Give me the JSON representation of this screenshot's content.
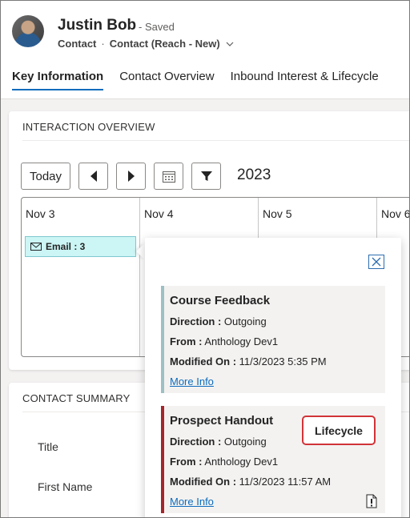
{
  "record": {
    "name": "Justin Bob",
    "saved_status": "- Saved",
    "entity": "Contact",
    "separator": "·",
    "form": "Contact (Reach - New)"
  },
  "tabs": [
    {
      "label": "Key Information",
      "active": true
    },
    {
      "label": "Contact Overview",
      "active": false
    },
    {
      "label": "Inbound Interest & Lifecycle",
      "active": false
    }
  ],
  "interaction_overview": {
    "title": "INTERACTION OVERVIEW",
    "today_label": "Today",
    "year": "2023",
    "days": [
      "Nov 3",
      "Nov 4",
      "Nov 5",
      "Nov 6"
    ],
    "email_chip": "Email : 3"
  },
  "popup": {
    "activities": [
      {
        "title": "Course Feedback",
        "direction_label": "Direction :",
        "direction": "Outgoing",
        "from_label": "From :",
        "from": "Anthology Dev1",
        "modified_label": "Modified On :",
        "modified": "11/3/2023 5:35 PM",
        "more_info": "More Info"
      },
      {
        "title": "Prospect Handout",
        "direction_label": "Direction :",
        "direction": "Outgoing",
        "from_label": "From :",
        "from": "Anthology Dev1",
        "modified_label": "Modified On :",
        "modified": "11/3/2023 11:57 AM",
        "more_info": "More Info",
        "badge": "Lifecycle"
      }
    ]
  },
  "contact_summary": {
    "title": "CONTACT SUMMARY",
    "fields": [
      "Title",
      "First Name"
    ]
  },
  "colors": {
    "accent": "#0f6cbd",
    "email_chip_bg": "#ccf5f5",
    "activity1_bar": "#9cc0c4",
    "activity2_bar": "#a4262c",
    "badge_border": "#d13438"
  }
}
